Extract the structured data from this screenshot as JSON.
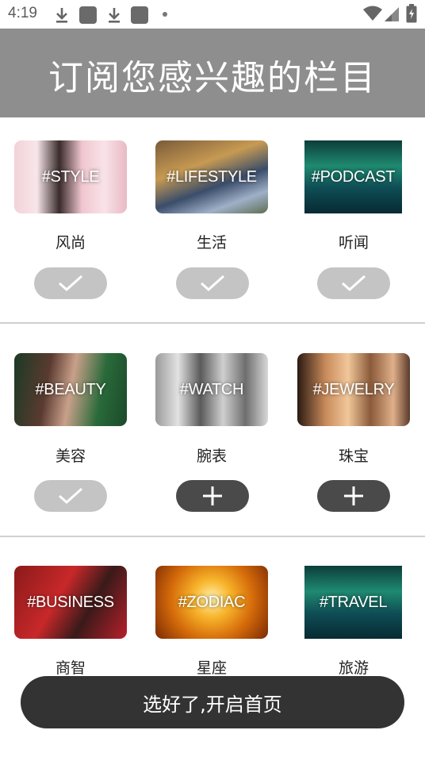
{
  "status_bar": {
    "time": "4:19"
  },
  "header": {
    "title": "订阅您感兴趣的栏目"
  },
  "items": [
    {
      "tag": "#STYLE",
      "label": "风尚",
      "subscribed": true
    },
    {
      "tag": "#LIFESTYLE",
      "label": "生活",
      "subscribed": true
    },
    {
      "tag": "#PODCAST",
      "label": "听闻",
      "subscribed": true
    },
    {
      "tag": "#BEAUTY",
      "label": "美容",
      "subscribed": true
    },
    {
      "tag": "#WATCH",
      "label": "腕表",
      "subscribed": false
    },
    {
      "tag": "#JEWELRY",
      "label": "珠宝",
      "subscribed": false
    },
    {
      "tag": "#BUSINESS",
      "label": "商智",
      "subscribed": null
    },
    {
      "tag": "#ZODIAC",
      "label": "星座",
      "subscribed": null
    },
    {
      "tag": "#TRAVEL",
      "label": "旅游",
      "subscribed": null
    }
  ],
  "start_button": {
    "label": "选好了,开启首页"
  },
  "colors": {
    "header_bg": "#8e8e8e",
    "subscribed_pill": "#c4c4c4",
    "add_pill": "#4a4a4a",
    "start_button": "#333333"
  },
  "icons": {
    "subscribed": "check-icon",
    "unsubscribed": "plus-icon"
  }
}
